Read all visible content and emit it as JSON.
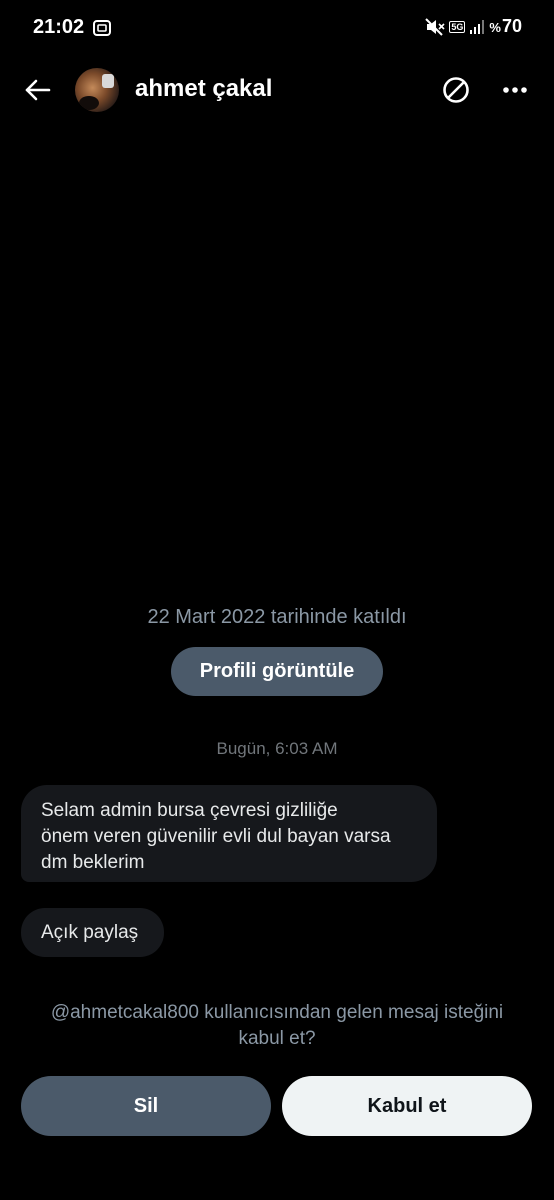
{
  "status_bar": {
    "time": "21:02",
    "network": "5G",
    "battery_symbol": "%",
    "battery_level": "70",
    "icons": [
      "screenshot-icon",
      "mute-icon",
      "signal-icon"
    ]
  },
  "header": {
    "name": "ahmet çakal",
    "icons": [
      "back-arrow-icon",
      "avatar",
      "block-icon",
      "more-icon"
    ]
  },
  "conversation": {
    "joined": "22 Mart 2022 tarihinde katıldı",
    "view_profile_label": "Profili görüntüle",
    "timestamp": "Bugün, 6:03 AM",
    "messages": [
      {
        "lines": [
          "Selam admin bursa çevresi gizliliğe",
          "önem veren güvenilir evli dul bayan varsa",
          "dm beklerim"
        ]
      },
      {
        "text": "Açık paylaş"
      }
    ]
  },
  "request": {
    "line1": "@ahmetcakal800 kullanıcısından gelen mesaj isteğini",
    "line2": "kabul et?"
  },
  "actions": {
    "delete_label": "Sil",
    "accept_label": "Kabul et"
  },
  "colors": {
    "background": "#000000",
    "bubble": "#16181c",
    "secondary_button": "#4b5a6a",
    "primary_button": "#eff3f4",
    "muted_text": "#8b98a5"
  }
}
